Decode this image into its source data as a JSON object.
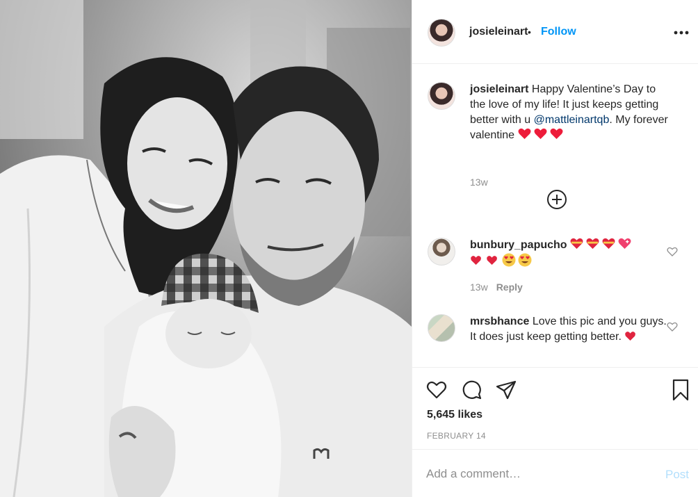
{
  "header": {
    "username": "josieleinart",
    "dot": "•",
    "follow_label": "Follow",
    "more_icon": "more-horizontal-icon"
  },
  "caption": {
    "username": "josieleinart",
    "text_before": " Happy Valentine’s Day to the love of my life! It just keeps getting better with u ",
    "mention": "@mattleinartqb",
    "text_after": ". My forever valentine ",
    "emojis": [
      "red-heart",
      "red-heart",
      "red-heart"
    ],
    "time": "13w"
  },
  "load_more_icon": "plus-circle-icon",
  "comments": [
    {
      "username": "bunbury_papucho",
      "text": " ",
      "emojis": [
        "heart-with-ribbon",
        "heart-with-ribbon",
        "heart-with-ribbon",
        "sparkling-heart",
        "two-hearts",
        "two-hearts",
        "heart-eyes-face",
        "heart-eyes-face"
      ],
      "time": "13w",
      "reply_label": "Reply"
    },
    {
      "username": "mrsbhance",
      "text": " Love this pic and you guys. It does just keep getting better. ",
      "emojis": [
        "two-hearts"
      ],
      "time": "",
      "reply_label": ""
    }
  ],
  "actions": {
    "like_icon": "heart-outline-icon",
    "comment_icon": "comment-bubble-icon",
    "share_icon": "paper-plane-icon",
    "save_icon": "bookmark-icon"
  },
  "likes_text": "5,645 likes",
  "date_text": "FEBRUARY 14",
  "add_comment": {
    "placeholder": "Add a comment…",
    "post_label": "Post"
  },
  "colors": {
    "follow": "#0095f6",
    "mention": "#00376b",
    "muted": "#8e8e8e",
    "post_disabled": "#b2dffc",
    "heart": "#ed1c3a"
  }
}
